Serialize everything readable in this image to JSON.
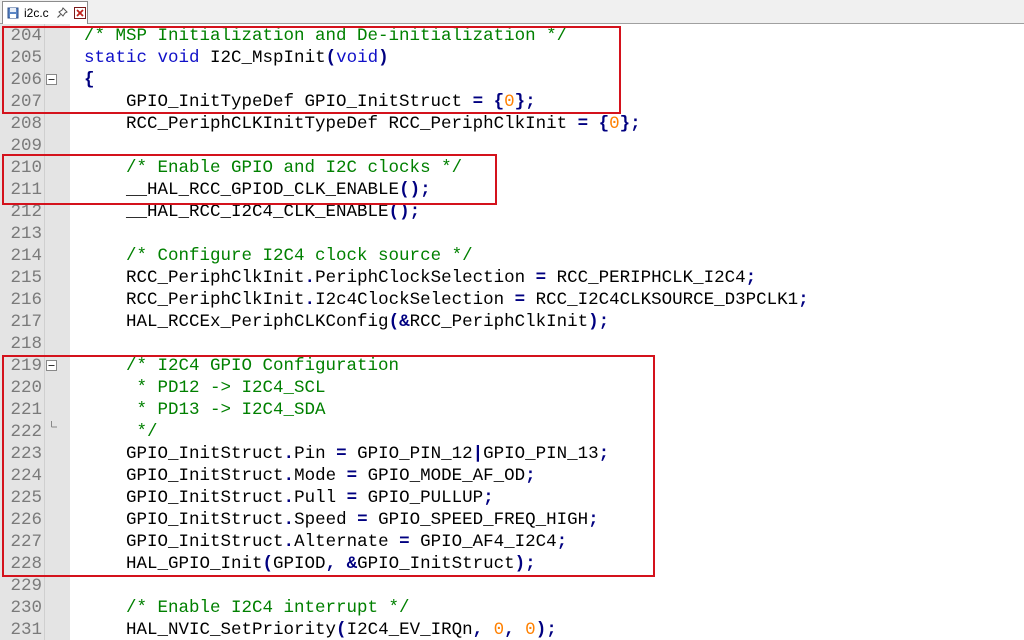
{
  "tab": {
    "label": "i2c.c"
  },
  "colors": {
    "comment": "#008000",
    "keyword": "#1010c8",
    "number": "#ff8000",
    "operator": "#000080",
    "highlight_box": "#d4121c",
    "gutter": "#e4e4e4"
  },
  "lines": [
    {
      "num": "204",
      "tokens": [
        [
          "/* MSP Initialization and De-initialization */",
          "cmt"
        ]
      ]
    },
    {
      "num": "205",
      "tokens": [
        [
          "static",
          "kw"
        ],
        [
          " ",
          ""
        ],
        [
          "void",
          "kw"
        ],
        [
          " I2C_MspInit",
          ""
        ],
        [
          "(",
          "op"
        ],
        [
          "void",
          "kw"
        ],
        [
          ")",
          "op"
        ]
      ]
    },
    {
      "num": "206",
      "tokens": [
        [
          "{",
          "op"
        ]
      ]
    },
    {
      "num": "207",
      "tokens": [
        [
          "    GPIO_InitTypeDef GPIO_InitStruct ",
          ""
        ],
        [
          "=",
          "op"
        ],
        [
          " ",
          ""
        ],
        [
          "{",
          "op"
        ],
        [
          "0",
          "num"
        ],
        [
          "};",
          "op"
        ]
      ]
    },
    {
      "num": "208",
      "tokens": [
        [
          "    RCC_PeriphCLKInitTypeDef RCC_PeriphClkInit ",
          ""
        ],
        [
          "=",
          "op"
        ],
        [
          " ",
          ""
        ],
        [
          "{",
          "op"
        ],
        [
          "0",
          "num"
        ],
        [
          "};",
          "op"
        ]
      ]
    },
    {
      "num": "209",
      "tokens": []
    },
    {
      "num": "210",
      "tokens": [
        [
          "    ",
          ""
        ],
        [
          "/* Enable GPIO and I2C clocks */",
          "cmt"
        ]
      ]
    },
    {
      "num": "211",
      "tokens": [
        [
          "    __HAL_RCC_GPIOD_CLK_ENABLE",
          ""
        ],
        [
          "();",
          "op"
        ]
      ]
    },
    {
      "num": "212",
      "tokens": [
        [
          "    __HAL_RCC_I2C4_CLK_ENABLE",
          ""
        ],
        [
          "();",
          "op"
        ]
      ]
    },
    {
      "num": "213",
      "tokens": []
    },
    {
      "num": "214",
      "tokens": [
        [
          "    ",
          ""
        ],
        [
          "/* Configure I2C4 clock source */",
          "cmt"
        ]
      ]
    },
    {
      "num": "215",
      "tokens": [
        [
          "    RCC_PeriphClkInit",
          ""
        ],
        [
          ".",
          "op"
        ],
        [
          "PeriphClockSelection ",
          ""
        ],
        [
          "=",
          "op"
        ],
        [
          " RCC_PERIPHCLK_I2C4",
          ""
        ],
        [
          ";",
          "op"
        ]
      ]
    },
    {
      "num": "216",
      "tokens": [
        [
          "    RCC_PeriphClkInit",
          ""
        ],
        [
          ".",
          "op"
        ],
        [
          "I2c4ClockSelection ",
          ""
        ],
        [
          "=",
          "op"
        ],
        [
          " RCC_I2C4CLKSOURCE_D3PCLK1",
          ""
        ],
        [
          ";",
          "op"
        ]
      ]
    },
    {
      "num": "217",
      "tokens": [
        [
          "    HAL_RCCEx_PeriphCLKConfig",
          ""
        ],
        [
          "(&",
          "op"
        ],
        [
          "RCC_PeriphClkInit",
          ""
        ],
        [
          ");",
          "op"
        ]
      ]
    },
    {
      "num": "218",
      "tokens": []
    },
    {
      "num": "219",
      "tokens": [
        [
          "    ",
          ""
        ],
        [
          "/* I2C4 GPIO Configuration",
          "cmt"
        ]
      ]
    },
    {
      "num": "220",
      "tokens": [
        [
          "     ",
          ""
        ],
        [
          "* PD12 -> I2C4_SCL",
          "cmt"
        ]
      ]
    },
    {
      "num": "221",
      "tokens": [
        [
          "     ",
          ""
        ],
        [
          "* PD13 -> I2C4_SDA",
          "cmt"
        ]
      ]
    },
    {
      "num": "222",
      "tokens": [
        [
          "     ",
          ""
        ],
        [
          "*/",
          "cmt"
        ]
      ]
    },
    {
      "num": "223",
      "tokens": [
        [
          "    GPIO_InitStruct",
          ""
        ],
        [
          ".",
          "op"
        ],
        [
          "Pin ",
          ""
        ],
        [
          "=",
          "op"
        ],
        [
          " GPIO_PIN_12",
          ""
        ],
        [
          "|",
          "op"
        ],
        [
          "GPIO_PIN_13",
          ""
        ],
        [
          ";",
          "op"
        ]
      ]
    },
    {
      "num": "224",
      "tokens": [
        [
          "    GPIO_InitStruct",
          ""
        ],
        [
          ".",
          "op"
        ],
        [
          "Mode ",
          ""
        ],
        [
          "=",
          "op"
        ],
        [
          " GPIO_MODE_AF_OD",
          ""
        ],
        [
          ";",
          "op"
        ]
      ]
    },
    {
      "num": "225",
      "tokens": [
        [
          "    GPIO_InitStruct",
          ""
        ],
        [
          ".",
          "op"
        ],
        [
          "Pull ",
          ""
        ],
        [
          "=",
          "op"
        ],
        [
          " GPIO_PULLUP",
          ""
        ],
        [
          ";",
          "op"
        ]
      ]
    },
    {
      "num": "226",
      "tokens": [
        [
          "    GPIO_InitStruct",
          ""
        ],
        [
          ".",
          "op"
        ],
        [
          "Speed ",
          ""
        ],
        [
          "=",
          "op"
        ],
        [
          " GPIO_SPEED_FREQ_HIGH",
          ""
        ],
        [
          ";",
          "op"
        ]
      ]
    },
    {
      "num": "227",
      "tokens": [
        [
          "    GPIO_InitStruct",
          ""
        ],
        [
          ".",
          "op"
        ],
        [
          "Alternate ",
          ""
        ],
        [
          "=",
          "op"
        ],
        [
          " GPIO_AF4_I2C4",
          ""
        ],
        [
          ";",
          "op"
        ]
      ]
    },
    {
      "num": "228",
      "tokens": [
        [
          "    HAL_GPIO_Init",
          ""
        ],
        [
          "(",
          "op"
        ],
        [
          "GPIOD",
          ""
        ],
        [
          ",",
          "op"
        ],
        [
          " ",
          ""
        ],
        [
          "&",
          "op"
        ],
        [
          "GPIO_InitStruct",
          ""
        ],
        [
          ");",
          "op"
        ]
      ]
    },
    {
      "num": "229",
      "tokens": []
    },
    {
      "num": "230",
      "tokens": [
        [
          "    ",
          ""
        ],
        [
          "/* Enable I2C4 interrupt */",
          "cmt"
        ]
      ]
    },
    {
      "num": "231",
      "tokens": [
        [
          "    HAL_NVIC_SetPriority",
          ""
        ],
        [
          "(",
          "op"
        ],
        [
          "I2C4_EV_IRQn",
          ""
        ],
        [
          ",",
          "op"
        ],
        [
          " ",
          ""
        ],
        [
          "0",
          "num"
        ],
        [
          ",",
          "op"
        ],
        [
          " ",
          ""
        ],
        [
          "0",
          "num"
        ],
        [
          ");",
          "op"
        ]
      ]
    }
  ]
}
